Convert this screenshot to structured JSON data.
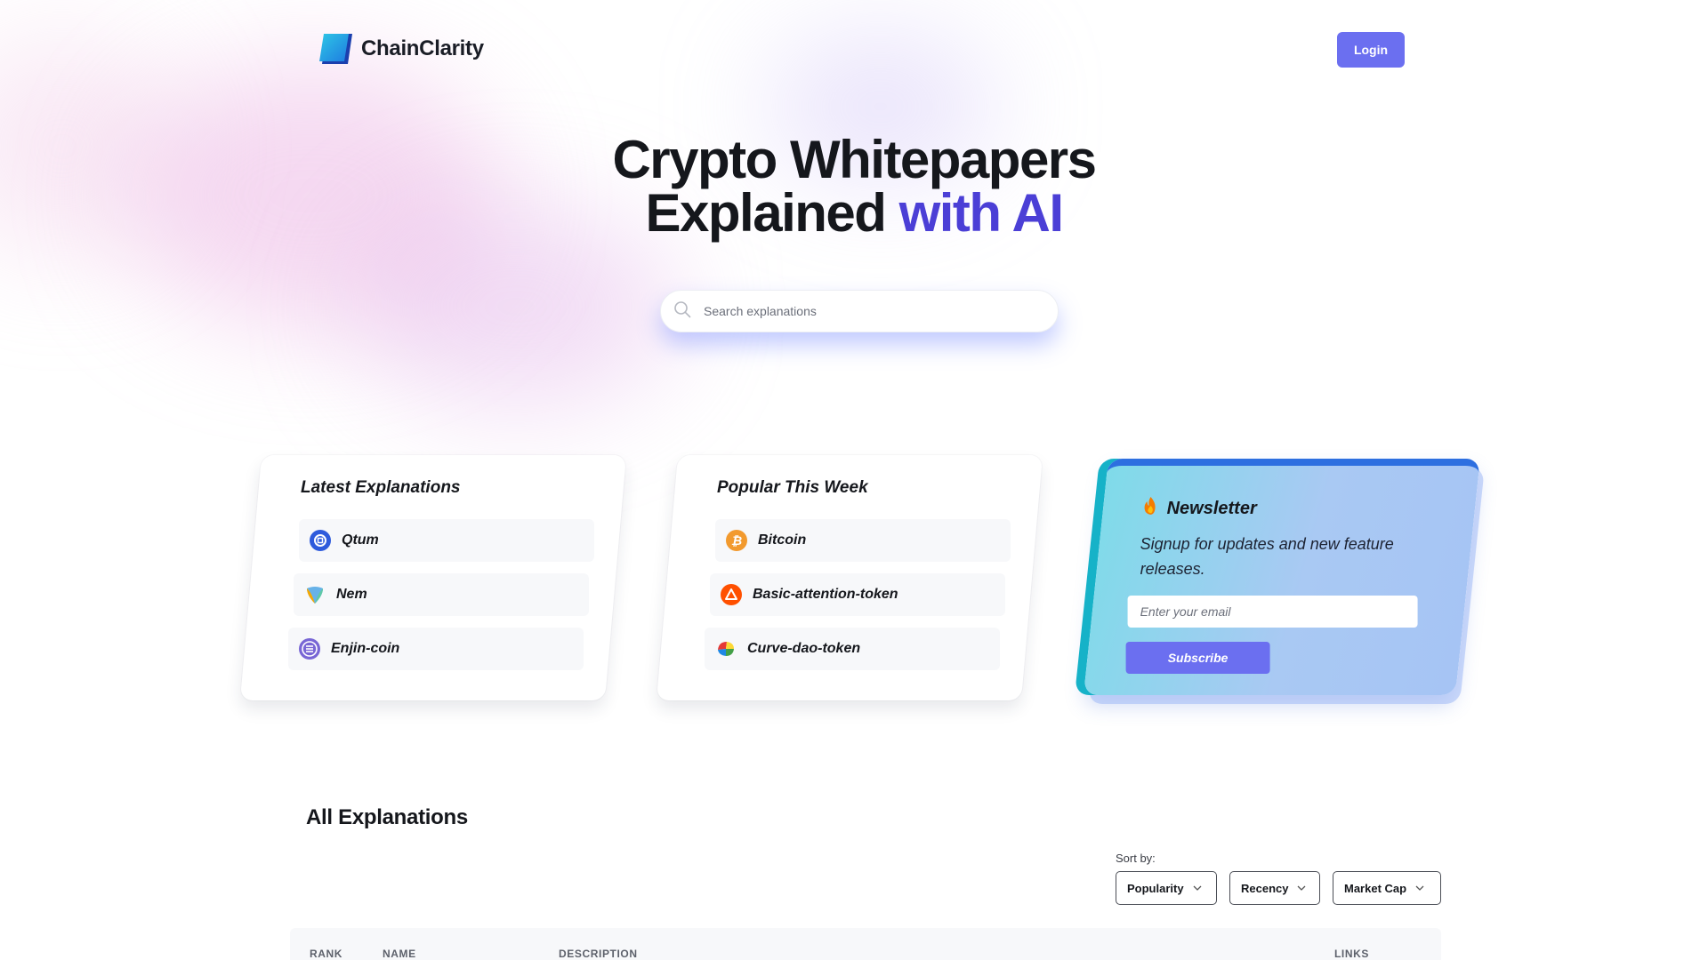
{
  "header": {
    "brand": "ChainClarity",
    "login_label": "Login"
  },
  "hero": {
    "line1": "Crypto Whitepapers",
    "line2_plain": "Explained ",
    "line2_accent": "with AI"
  },
  "search": {
    "placeholder": "Search explanations"
  },
  "latest": {
    "title": "Latest Explanations",
    "items": [
      {
        "label": "Qtum",
        "icon": "qtum-icon"
      },
      {
        "label": "Nem",
        "icon": "nem-icon"
      },
      {
        "label": "Enjin-coin",
        "icon": "enjin-coin-icon"
      }
    ]
  },
  "popular": {
    "title": "Popular This Week",
    "items": [
      {
        "label": "Bitcoin",
        "icon": "bitcoin-icon"
      },
      {
        "label": "Basic-attention-token",
        "icon": "basic-attention-token-icon"
      },
      {
        "label": "Curve-dao-token",
        "icon": "curve-dao-token-icon"
      }
    ]
  },
  "newsletter": {
    "title": "Newsletter",
    "icon": "fire-icon",
    "description": "Signup for updates and new feature releases.",
    "email_placeholder": "Enter your email",
    "subscribe_label": "Subscribe"
  },
  "all_explanations": {
    "title": "All Explanations",
    "sort_label": "Sort by:",
    "sort_options": [
      "Popularity",
      "Recency",
      "Market Cap"
    ],
    "columns": [
      "RANK",
      "NAME",
      "DESCRIPTION",
      "LINKS"
    ]
  },
  "colors": {
    "accent": "#6b6ff0",
    "heading_accent": "#4b3fd6"
  }
}
